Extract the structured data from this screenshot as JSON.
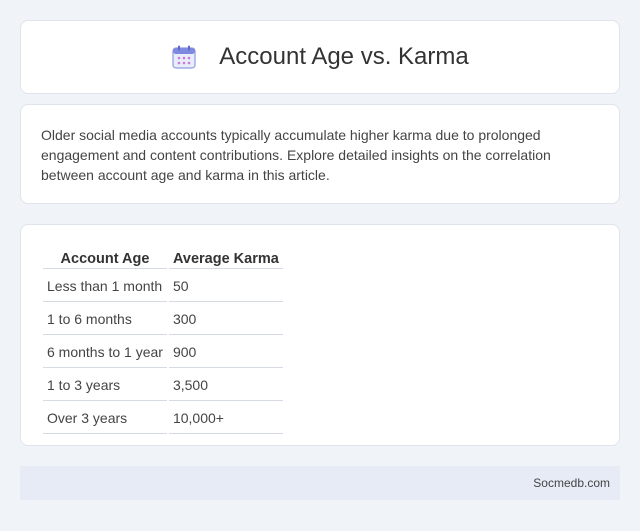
{
  "header": {
    "title": "Account Age vs. Karma",
    "icon": "calendar-icon"
  },
  "intro": {
    "text": "Older social media accounts typically accumulate higher karma due to prolonged engagement and content contributions. Explore detailed insights on the correlation between account age and karma in this article."
  },
  "table": {
    "columns": [
      "Account Age",
      "Average Karma"
    ],
    "rows": [
      [
        "Less than 1 month",
        "50"
      ],
      [
        "1 to 6 months",
        "300"
      ],
      [
        "6 months to 1 year",
        "900"
      ],
      [
        "1 to 3 years",
        "3,500"
      ],
      [
        "Over 3 years",
        "10,000+"
      ]
    ]
  },
  "footer": {
    "brand": "Socmedb.com"
  },
  "colors": {
    "page_background": "#f0f3f8",
    "card_background": "#ffffff",
    "footer_background": "#e6ebf5",
    "icon_accent": "#6f7fdc"
  }
}
